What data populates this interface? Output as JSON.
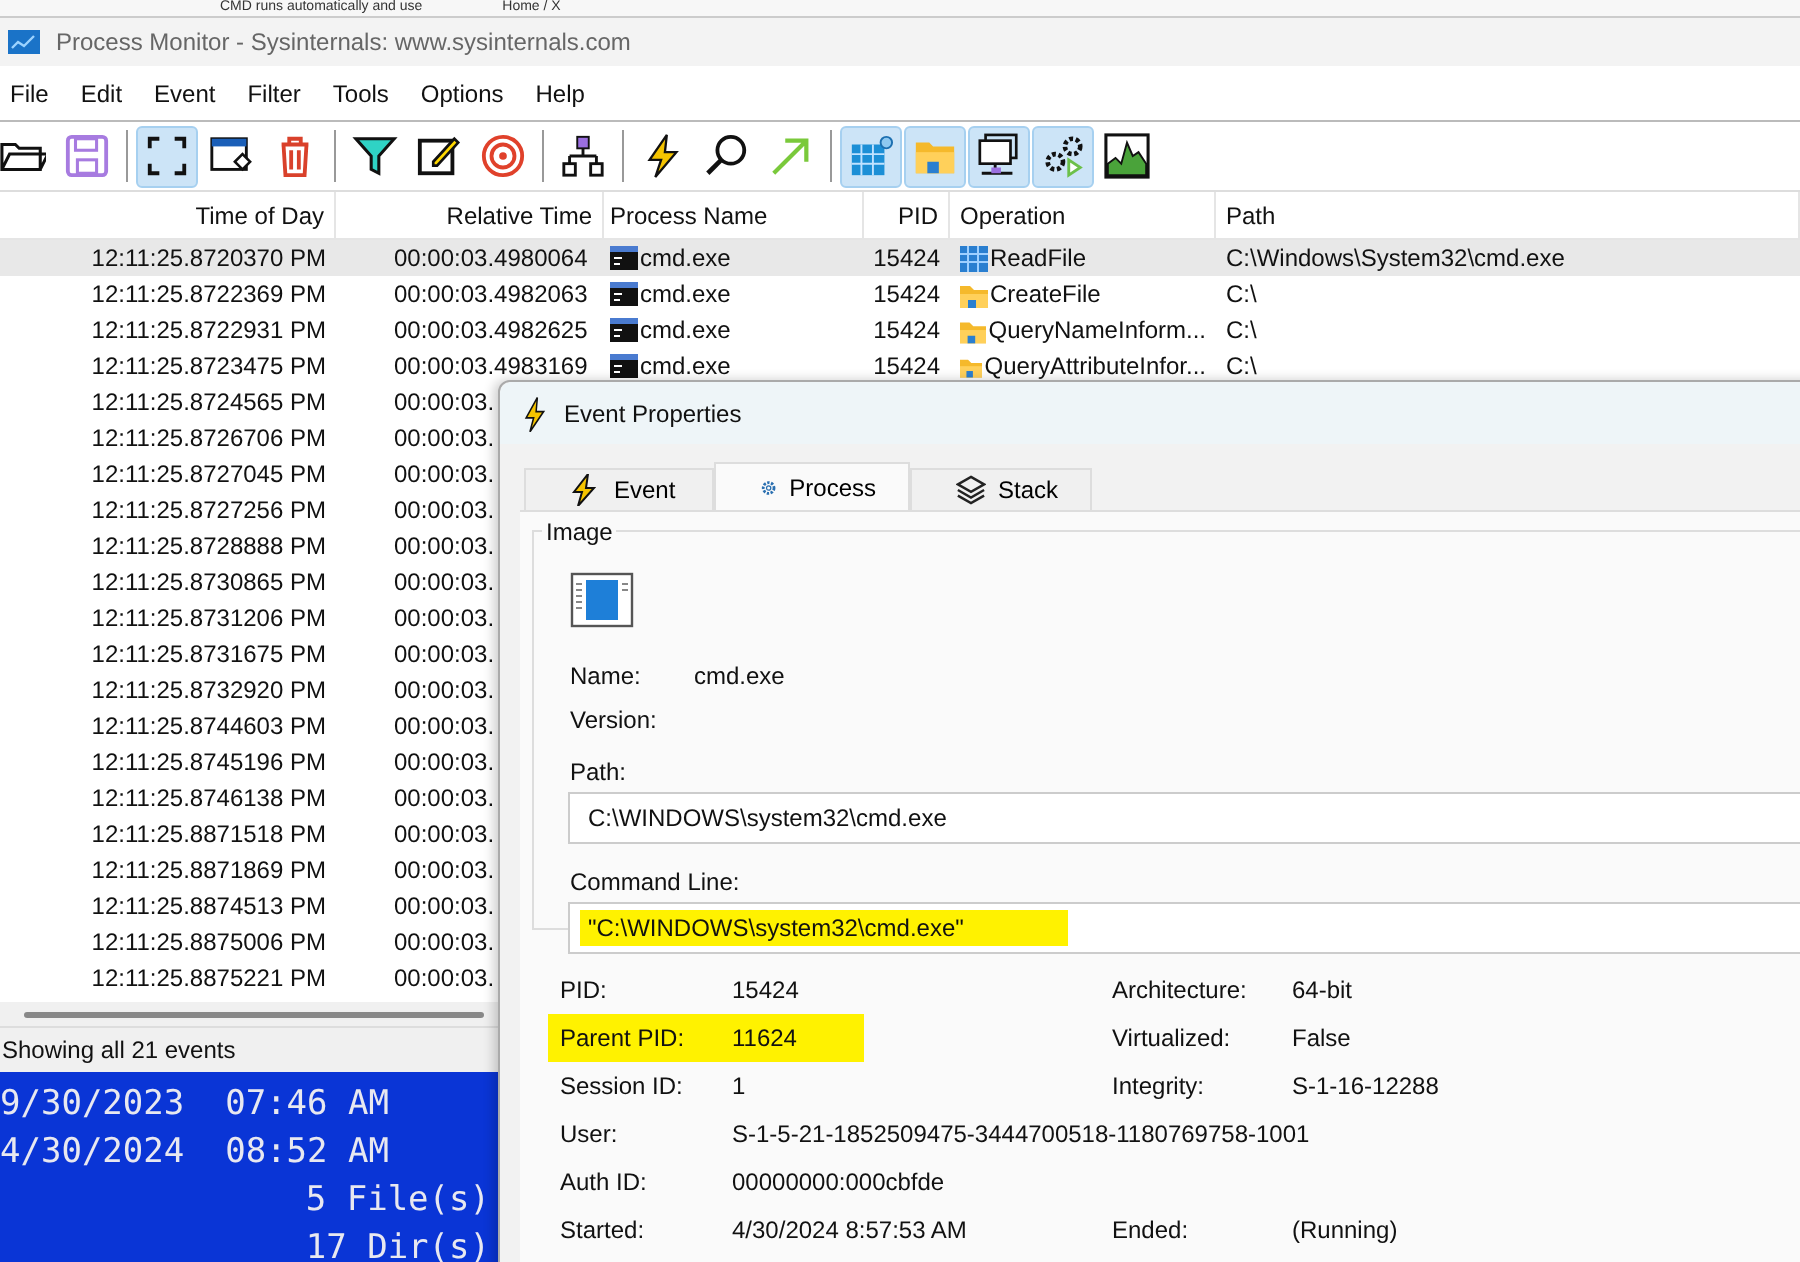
{
  "browser_tabs": [
    {
      "title": "CMD runs automatically and use"
    },
    {
      "title": "Home / X"
    }
  ],
  "window": {
    "title": "Process Monitor - Sysinternals: www.sysinternals.com"
  },
  "menu": [
    "File",
    "Edit",
    "Event",
    "Filter",
    "Tools",
    "Options",
    "Help"
  ],
  "toolbar": [
    {
      "selected": false
    },
    {
      "selected": false
    },
    {
      "selected": true
    },
    {
      "selected": false
    },
    {
      "selected": false
    },
    {
      "selected": false
    },
    {
      "selected": false
    },
    {
      "selected": false
    },
    {
      "selected": false
    },
    {
      "selected": false
    },
    {
      "selected": false
    },
    {
      "selected": false
    },
    {
      "selected": true
    },
    {
      "selected": true
    },
    {
      "selected": true
    },
    {
      "selected": true
    },
    {
      "selected": false
    }
  ],
  "table": {
    "columns": [
      "Time of Day",
      "Relative Time",
      "Process Name",
      "PID",
      "Operation",
      "Path"
    ],
    "rows": [
      {
        "selected": true,
        "time": "12:11:25.8720370 PM",
        "relative": "00:00:03.4980064",
        "process": "cmd.exe",
        "pid": "15424",
        "operation": "ReadFile",
        "path": "C:\\Windows\\System32\\cmd.exe"
      },
      {
        "selected": false,
        "time": "12:11:25.8722369 PM",
        "relative": "00:00:03.4982063",
        "process": "cmd.exe",
        "pid": "15424",
        "operation": "CreateFile",
        "path": "C:\\"
      },
      {
        "selected": false,
        "time": "12:11:25.8722931 PM",
        "relative": "00:00:03.4982625",
        "process": "cmd.exe",
        "pid": "15424",
        "operation": "QueryNameInform...",
        "path": "C:\\"
      },
      {
        "selected": false,
        "time": "12:11:25.8723475 PM",
        "relative": "00:00:03.4983169",
        "process": "cmd.exe",
        "pid": "15424",
        "operation": "QueryAttributeInfor...",
        "path": "C:\\"
      },
      {
        "selected": false,
        "time": "12:11:25.8724565 PM",
        "relative": "00:00:03."
      },
      {
        "selected": false,
        "time": "12:11:25.8726706 PM",
        "relative": "00:00:03."
      },
      {
        "selected": false,
        "time": "12:11:25.8727045 PM",
        "relative": "00:00:03."
      },
      {
        "selected": false,
        "time": "12:11:25.8727256 PM",
        "relative": "00:00:03."
      },
      {
        "selected": false,
        "time": "12:11:25.8728888 PM",
        "relative": "00:00:03."
      },
      {
        "selected": false,
        "time": "12:11:25.8730865 PM",
        "relative": "00:00:03."
      },
      {
        "selected": false,
        "time": "12:11:25.8731206 PM",
        "relative": "00:00:03."
      },
      {
        "selected": false,
        "time": "12:11:25.8731675 PM",
        "relative": "00:00:03."
      },
      {
        "selected": false,
        "time": "12:11:25.8732920 PM",
        "relative": "00:00:03."
      },
      {
        "selected": false,
        "time": "12:11:25.8744603 PM",
        "relative": "00:00:03."
      },
      {
        "selected": false,
        "time": "12:11:25.8745196 PM",
        "relative": "00:00:03."
      },
      {
        "selected": false,
        "time": "12:11:25.8746138 PM",
        "relative": "00:00:03."
      },
      {
        "selected": false,
        "time": "12:11:25.8871518 PM",
        "relative": "00:00:03."
      },
      {
        "selected": false,
        "time": "12:11:25.8871869 PM",
        "relative": "00:00:03."
      },
      {
        "selected": false,
        "time": "12:11:25.8874513 PM",
        "relative": "00:00:03."
      },
      {
        "selected": false,
        "time": "12:11:25.8875006 PM",
        "relative": "00:00:03."
      },
      {
        "selected": false,
        "time": "12:11:25.8875221 PM",
        "relative": "00:00:03."
      }
    ]
  },
  "status_bar": "Showing all 21 events",
  "console": {
    "lines": [
      {
        "kind": "date",
        "text": "9/30/2023  07:46 AM"
      },
      {
        "kind": "date",
        "text": "4/30/2024  08:52 AM"
      },
      {
        "kind": "summary",
        "text": "5 File(s)"
      },
      {
        "kind": "summary",
        "text": "17 Dir(s)"
      }
    ]
  },
  "dialog": {
    "title": "Event Properties",
    "tabs": [
      {
        "label": "Event",
        "selected": false
      },
      {
        "label": "Process",
        "selected": true
      },
      {
        "label": "Stack",
        "selected": false
      }
    ],
    "image": {
      "title": "Image",
      "fields": [
        {
          "label": "Name:",
          "value": "cmd.exe"
        },
        {
          "label": "Version:"
        }
      ],
      "path": {
        "label": "Path:",
        "value": "C:\\WINDOWS\\system32\\cmd.exe",
        "highlighted": false
      },
      "command_line": {
        "label": "Command Line:",
        "value": "\"C:\\WINDOWS\\system32\\cmd.exe\"",
        "highlighted": true
      }
    },
    "details": [
      {
        "label": "PID:",
        "value": "15424",
        "highlighted": false,
        "right_label": "Architecture:",
        "right_value": "64-bit"
      },
      {
        "label": "Parent PID:",
        "value": "11624",
        "highlighted": true,
        "right_label": "Virtualized:",
        "right_value": "False"
      },
      {
        "label": "Session ID:",
        "value": "1",
        "highlighted": false,
        "right_label": "Integrity:",
        "right_value": "S-1-16-12288"
      },
      {
        "label": "User:",
        "value": "S-1-5-21-1852509475-3444700518-1180769758-1001",
        "highlighted": false
      },
      {
        "label": "Auth ID:",
        "value": "00000000:000cbfde",
        "highlighted": false
      },
      {
        "label": "Started:",
        "value": "4/30/2024 8:57:53 AM",
        "highlighted": false,
        "right_label": "Ended:",
        "right_value": "(Running)"
      }
    ]
  }
}
